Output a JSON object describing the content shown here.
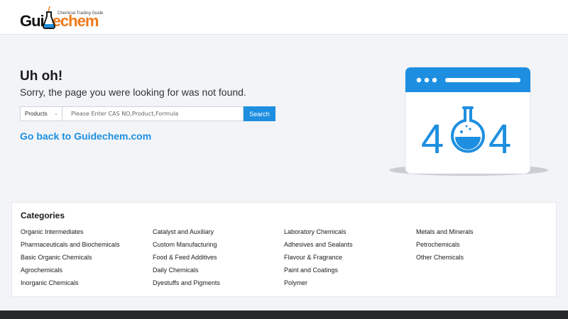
{
  "logo": {
    "tagline": "Chemical Trading Guide",
    "word_part1": "Gui",
    "word_part2": "echem"
  },
  "error": {
    "title": "Uh oh!",
    "message": "Sorry, the page you were looking for was not found."
  },
  "search": {
    "category": "Products",
    "placeholder": "Please Enter CAS NO,Product,Formula",
    "button_label": "Search"
  },
  "back_link": "Go back to Guidechem.com",
  "illustration": {
    "text_left": "4",
    "text_right": "4",
    "accent": "#1e8fe0"
  },
  "categories": {
    "title": "Categories",
    "columns": [
      [
        "Organic Intermediates",
        "Pharmaceuticals and Biochemicals",
        "Basic Organic Chemicals",
        "Agrochemicals",
        "Inorganic Chemicals"
      ],
      [
        "Catalyst and Auxiliary",
        "Custom Manufacturing",
        "Food & Feed Additives",
        "Daily Chemicals",
        "Dyestuffs and Pigments"
      ],
      [
        "Laboratory Chemicals",
        "Adhesives and Sealants",
        "Flavour & Fragrance",
        "Paint and Coatings",
        "Polymer"
      ],
      [
        "Metals and Minerals",
        "Petrochemicals",
        "Other Chemicals"
      ]
    ]
  },
  "colors": {
    "accent": "#1e8fe0",
    "logo_orange": "#f07a1a",
    "footer": "#25272b"
  }
}
